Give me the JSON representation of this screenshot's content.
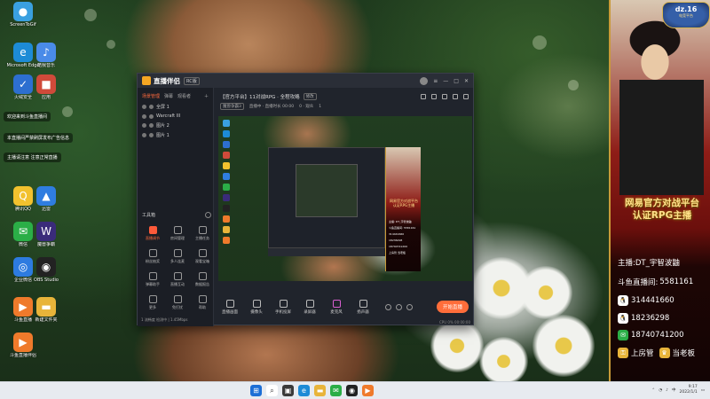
{
  "desktop": {
    "icons": [
      {
        "name": "screen-recorder",
        "label": "ScreenToGif",
        "color": "#3aa0e0",
        "glyph": "●"
      },
      {
        "name": "edge",
        "label": "Microsoft Edge",
        "color": "#1d8bd6",
        "glyph": "e"
      },
      {
        "name": "app-two",
        "label": "酷我音乐",
        "color": "#4a8be8",
        "glyph": "♪"
      },
      {
        "name": "security",
        "label": "火绒安全",
        "color": "#2d6fd0",
        "glyph": "✓"
      },
      {
        "name": "app-four",
        "label": "应用",
        "color": "#d04a3a",
        "glyph": "■"
      },
      {
        "name": "qq",
        "label": "腾讯QQ",
        "color": "#f2c12e",
        "glyph": "Q"
      },
      {
        "name": "app-six",
        "label": "迅雷",
        "color": "#2f7de0",
        "glyph": "▲"
      },
      {
        "name": "wechat",
        "label": "微信",
        "color": "#2bae47",
        "glyph": "✉"
      },
      {
        "name": "game",
        "label": "魔兽争霸",
        "color": "#3a2b7a",
        "glyph": "W"
      },
      {
        "name": "app-nine",
        "label": "企业微信",
        "color": "#2d7be0",
        "glyph": "◎"
      },
      {
        "name": "obs",
        "label": "OBS Studio",
        "color": "#222",
        "glyph": "◉"
      },
      {
        "name": "live",
        "label": "斗鱼直播",
        "color": "#ef7a2b",
        "glyph": "▶"
      },
      {
        "name": "folder",
        "label": "新建文件夹",
        "color": "#e8b43a",
        "glyph": "▬"
      },
      {
        "name": "live-two",
        "label": "斗鱼直播伴侣",
        "color": "#ef7a2b",
        "glyph": "▶"
      }
    ],
    "chat": [
      "欢迎来到斗鱼直播间",
      "本直播间严禁刷屏发布广告信息",
      "主播请注意 注意正常直播"
    ]
  },
  "streamer_panel": {
    "badge_title": "dz.16",
    "badge_sub": "电竞平台",
    "brand_line1": "网易官方对战平台",
    "brand_line2": "认证RPG主播",
    "host_label": "主播:",
    "host_name": "DT_宇智波鼬",
    "room_label": "斗鱼直播间:",
    "room_id": "5581161",
    "qq1": "314441660",
    "qq2": "18236298",
    "wechat": "18740741200",
    "upper_label": "上房管",
    "upper_right": "当老板"
  },
  "app": {
    "name": "直播伴侣",
    "version": "RC版",
    "scene_tabs": [
      "场景管理",
      "弹幕",
      "观看者"
    ],
    "sources": [
      "全屏 1",
      "Warcraft III",
      "图片 2",
      "图片 1"
    ],
    "toolbox_title": "工具箱",
    "tools_row1": [
      "直播调节",
      "房间管理",
      "主播任务"
    ],
    "tools_row2": [
      "粉丝抽奖",
      "多人连麦",
      "观看宝箱"
    ],
    "tools_row3": [
      "弹幕助手",
      "直播互动",
      "数据报告"
    ],
    "tools_row4": [
      "更多",
      "免打扰",
      "帮助"
    ],
    "left_footer": "1 流畅度  检测中 | 1.45Mbps",
    "room_title": "【官方平台】11对战RPG · 全程攻略",
    "room_tag": "修改",
    "room_cat": "魔兽争霸3",
    "room_status": "直播中 · 直播时长 00:00",
    "room_dur": "0 · 观众",
    "room_count": "1",
    "bottom": [
      "直播画面",
      "摄像头",
      "手机投屏",
      "录屏器",
      "麦克风",
      "扬声器"
    ],
    "go_live": "开始直播",
    "cpu": "CPU 0% 00:00:00"
  },
  "nested": {
    "brand": "网易官方对战平台 认证RPG主播",
    "lines": [
      "主播: DT_宇智波鼬",
      "斗鱼直播间: 5581161",
      "314441660",
      "18236298",
      "18740741200",
      "上房管  当老板"
    ]
  },
  "taskbar": {
    "time": "9:17",
    "date": "2022/1/1",
    "tray_text": "中"
  }
}
